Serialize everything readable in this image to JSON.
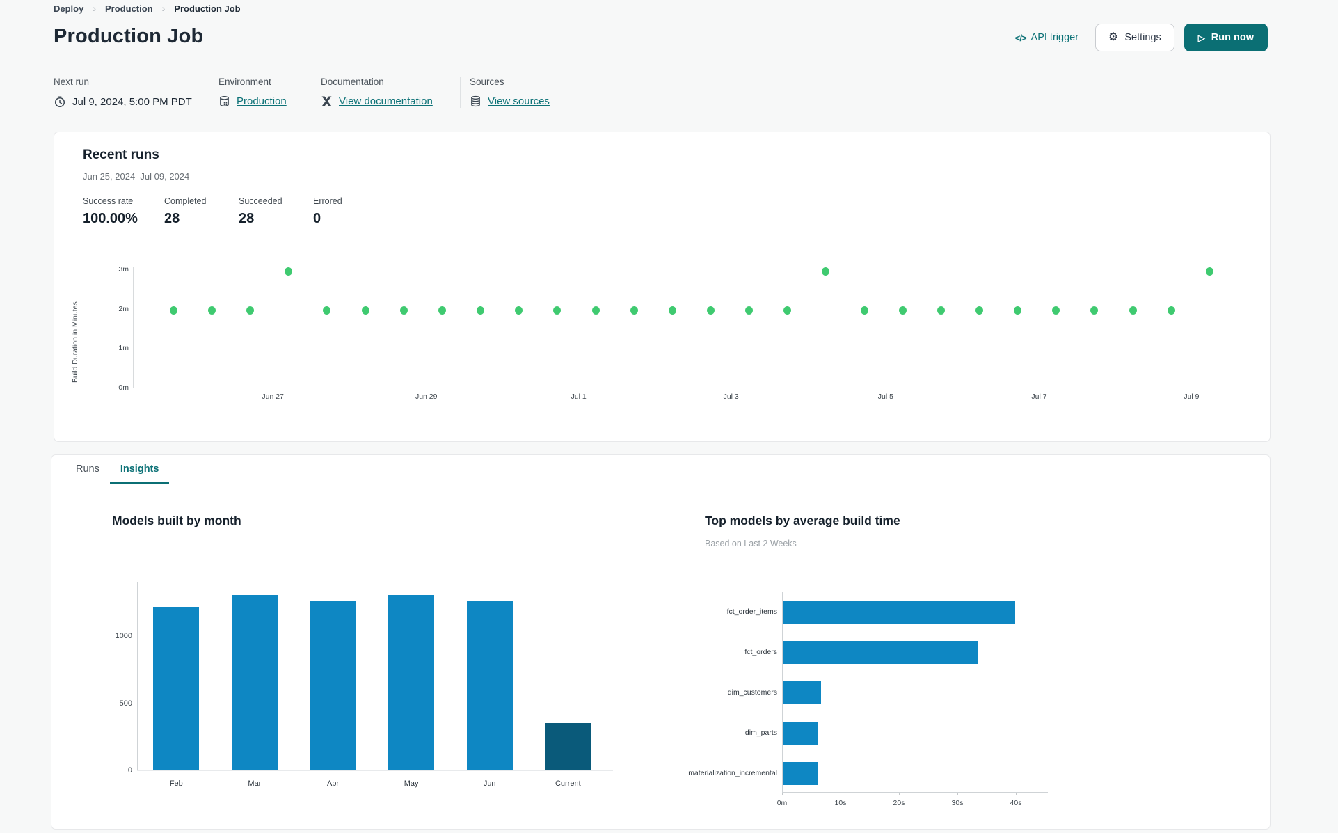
{
  "breadcrumb": {
    "items": [
      {
        "label": "Deploy"
      },
      {
        "label": "Production"
      },
      {
        "label": "Production Job"
      }
    ]
  },
  "header": {
    "title": "Production Job",
    "api_trigger_label": "API trigger",
    "api_trigger_glyph": "</>",
    "settings_label": "Settings",
    "run_now_label": "Run now"
  },
  "info": {
    "columns": [
      {
        "label": "Next run",
        "value": "Jul 9, 2024, 5:00 PM PDT",
        "icon": "clock-icon",
        "is_link": false
      },
      {
        "label": "Environment",
        "value": "Production",
        "icon": "database-icon",
        "is_link": true
      },
      {
        "label": "Documentation",
        "value": "View documentation",
        "icon": "dbt-logo-icon",
        "is_link": true
      },
      {
        "label": "Sources",
        "value": "View sources",
        "icon": "sources-icon",
        "is_link": true
      }
    ]
  },
  "recent_runs": {
    "title": "Recent runs",
    "date_range": "Jun 25, 2024–Jul 09, 2024",
    "stats": [
      {
        "label": "Success rate",
        "value": "100.00%"
      },
      {
        "label": "Completed",
        "value": "28"
      },
      {
        "label": "Succeeded",
        "value": "28"
      },
      {
        "label": "Errored",
        "value": "0"
      }
    ]
  },
  "tabs": [
    {
      "label": "Runs",
      "active": false
    },
    {
      "label": "Insights",
      "active": true
    }
  ],
  "colors": {
    "accent_teal": "#0b6f74",
    "link_teal": "#0d7277",
    "dot_green": "#3fca70",
    "bar_blue": "#0e87c3",
    "bar_dark": "#0a5a7a",
    "text_dark": "#1e2935",
    "text_gray": "#4a525a"
  },
  "chart_data": [
    {
      "id": "build-duration-scatter",
      "type": "scatter",
      "ylabel": "Build Duration in Minutes",
      "yticks": [
        "0m",
        "1m",
        "2m",
        "3m"
      ],
      "ylim_minutes": [
        0,
        3.3
      ],
      "xticks": [
        "Jun 27",
        "Jun 29",
        "Jul 1",
        "Jul 3",
        "Jul 5",
        "Jul 7",
        "Jul 9"
      ],
      "point_color": "#3fca70",
      "durations_minutes": [
        1.95,
        1.95,
        1.95,
        2.95,
        1.95,
        1.95,
        1.95,
        1.95,
        1.95,
        1.95,
        1.95,
        1.95,
        1.95,
        1.95,
        1.95,
        1.95,
        1.95,
        2.95,
        1.95,
        1.95,
        1.95,
        1.95,
        1.95,
        1.95,
        1.95,
        1.95,
        1.95,
        2.95
      ]
    },
    {
      "id": "models-built-by-month",
      "type": "bar",
      "title": "Models built by month",
      "categories": [
        "Feb",
        "Mar",
        "Apr",
        "May",
        "Jun",
        "Current"
      ],
      "values": [
        1220,
        1305,
        1260,
        1305,
        1265,
        350
      ],
      "yticks": [
        0,
        500,
        1000
      ],
      "ylim": [
        0,
        1400
      ],
      "bar_color": "#0e87c3",
      "highlight_category": "Current",
      "highlight_color": "#0a5a7a"
    },
    {
      "id": "top-models-by-build-time",
      "type": "bar-horizontal",
      "title": "Top models by average build time",
      "subtitle": "Based on Last 2 Weeks",
      "categories": [
        "fct_order_items",
        "fct_orders",
        "dim_customers",
        "dim_parts",
        "materialization_incremental"
      ],
      "values_seconds": [
        39.8,
        33.3,
        6.5,
        6.0,
        5.9
      ],
      "xticks": [
        "0m",
        "10s",
        "20s",
        "30s",
        "40s"
      ],
      "xlim_seconds": [
        0,
        44
      ],
      "bar_color": "#0e87c3"
    }
  ]
}
